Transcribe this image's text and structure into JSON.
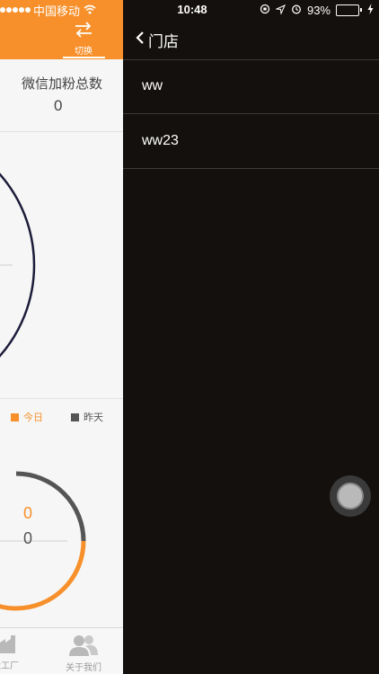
{
  "status_bar": {
    "carrier": "中国移动",
    "time": "10:48",
    "battery_percent": "93%",
    "battery_level": 0.93
  },
  "left_page": {
    "switch_label": "切换",
    "stat_title": "微信加粉总数",
    "stat_value": "0",
    "legend": {
      "today": "今日",
      "yesterday": "昨天"
    },
    "donut": {
      "today_value": "0",
      "yesterday_value": "0"
    },
    "tabs": [
      {
        "label": "造工厂",
        "icon": "factory-icon"
      },
      {
        "label": "关于我们",
        "icon": "people-icon"
      }
    ]
  },
  "panel": {
    "back_label": "门店",
    "stores": [
      "ww",
      "ww23"
    ]
  },
  "colors": {
    "accent": "#f7902b",
    "panel_bg": "#13100d",
    "dark_series": "#555555",
    "circle": "#1c1c3a"
  }
}
